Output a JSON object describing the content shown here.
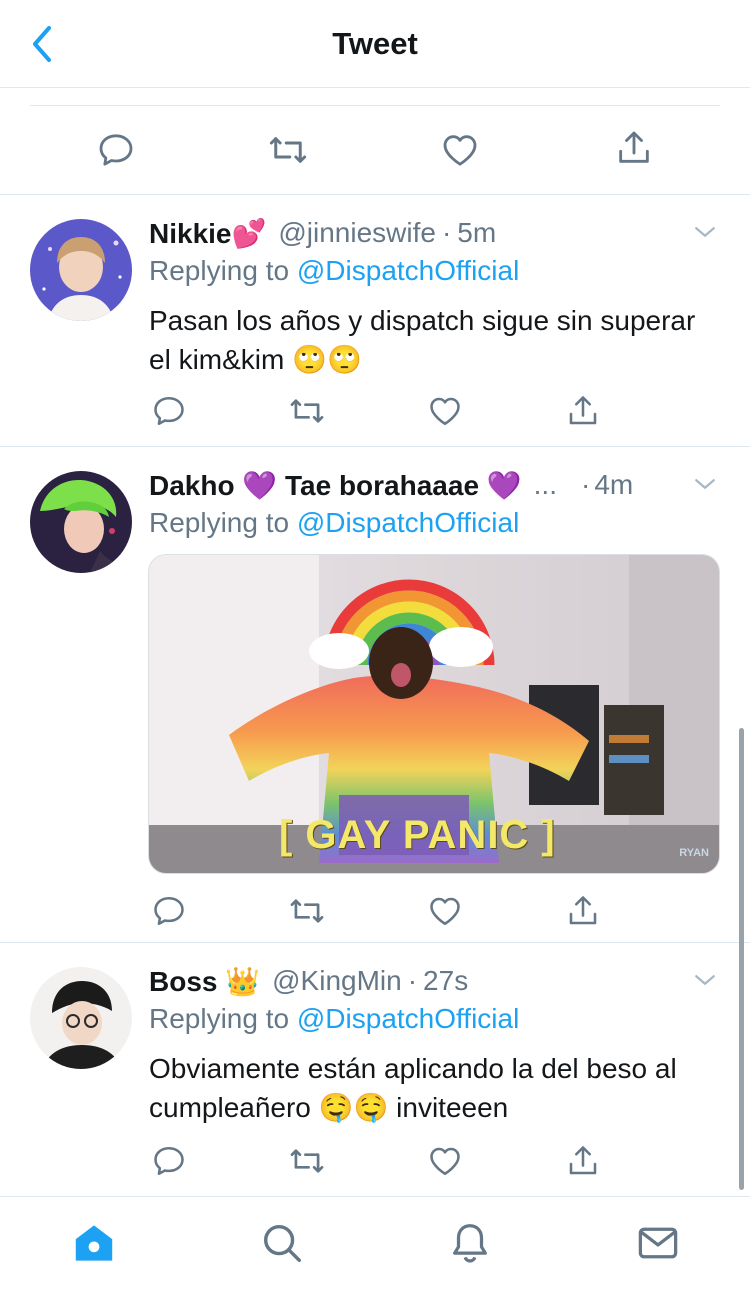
{
  "header": {
    "title": "Tweet",
    "back_icon": "chevron-left-icon"
  },
  "colors": {
    "accent": "#1da1f2",
    "text_primary": "#14171a",
    "text_secondary": "#657786",
    "divider": "#e1e8ed"
  },
  "main_tweet_actions": [
    "reply-icon",
    "retweet-icon",
    "like-icon",
    "share-icon"
  ],
  "tweets": [
    {
      "name": "Nikkie💕",
      "handle": "@jinnieswife",
      "separator": "·",
      "time": "5m",
      "replying_prefix": "Replying to",
      "replying_to": "@DispatchOfficial",
      "text": "Pasan los años y dispatch sigue sin superar el kim&kim 🙄🙄"
    },
    {
      "name": "Dakho 💜 Tae borahaaae 💜",
      "ellipsis": "...",
      "separator": "·",
      "time": "4m",
      "replying_prefix": "Replying to",
      "replying_to": "@DispatchOfficial",
      "media_caption": "[ GAY PANIC ]",
      "media_watermark": "RYAN"
    },
    {
      "name": "Boss 👑",
      "handle": "@KingMin",
      "separator": "·",
      "time": "27s",
      "replying_prefix": "Replying to",
      "replying_to": "@DispatchOfficial",
      "text": "Obviamente están aplicando la del beso al cumpleañero 🤤🤤 inviteeen"
    }
  ],
  "tabbar": {
    "items": [
      "home-icon",
      "search-icon",
      "notifications-icon",
      "messages-icon"
    ],
    "active": "home"
  }
}
